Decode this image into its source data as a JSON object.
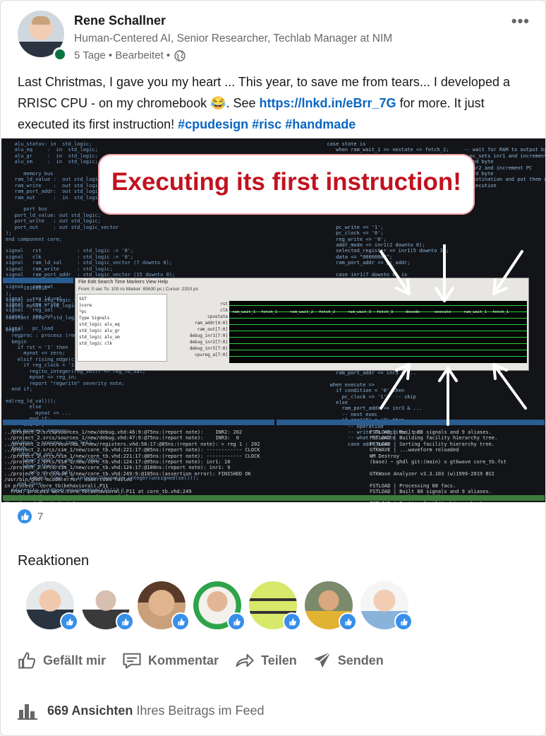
{
  "author": {
    "name": "Rene Schallner",
    "headline": "Human-Centered AI, Senior Researcher, Techlab Manager at NIM",
    "meta": "5 Tage • Bearbeitet •",
    "more_icon": "more-horizontal-icon"
  },
  "post": {
    "text_plain": "Last Christmas, I gave you my heart ... This year, to save me from tears... I developed a RRISC CPU - on my chromebook 😂. See ",
    "link": "https://lnkd.in/eBrr_7G",
    "text_after": " for more. It just executed its first instruction! ",
    "hashtags": [
      "#cpudesign",
      "#risc",
      "#handmade"
    ]
  },
  "image": {
    "banner": "Executing its first instruction!",
    "gtk_menu": "File  Edit  Search  Time  Markers  View  Help",
    "gtk_toolbar": "From: 0 sec   To: 100 ns    Marker: 85630 ps  |  Cursor: 2310 ps",
    "signals": [
      "rst",
      "clk",
      "cpustate",
      "ram_addr[4:0]",
      "ram_out[7:0]",
      "debug_inr1[7:0]",
      "debug_inr2[7:0]",
      "debug_inr3[7:0]",
      "cpureg_a[7:0]"
    ],
    "wave_labels": [
      "ram_wait_1",
      "fetch_1",
      "ram_wait_2",
      "fetch_2",
      "ram_wait_3",
      "fetch_3",
      "decode",
      "execute",
      "ram_wait_1",
      "fetch_1"
    ]
  },
  "reactions": {
    "count": "7",
    "title": "Reaktionen"
  },
  "actions": [
    {
      "label": "Gefällt mir",
      "icon": "thumbs-up-icon"
    },
    {
      "label": "Kommentar",
      "icon": "comment-icon"
    },
    {
      "label": "Teilen",
      "icon": "share-arrow-icon"
    },
    {
      "label": "Senden",
      "icon": "send-icon"
    }
  ],
  "views": {
    "count": "669 Ansichten",
    "suffix": "Ihres Beitrags im Feed",
    "icon": "bar-chart-icon"
  }
}
